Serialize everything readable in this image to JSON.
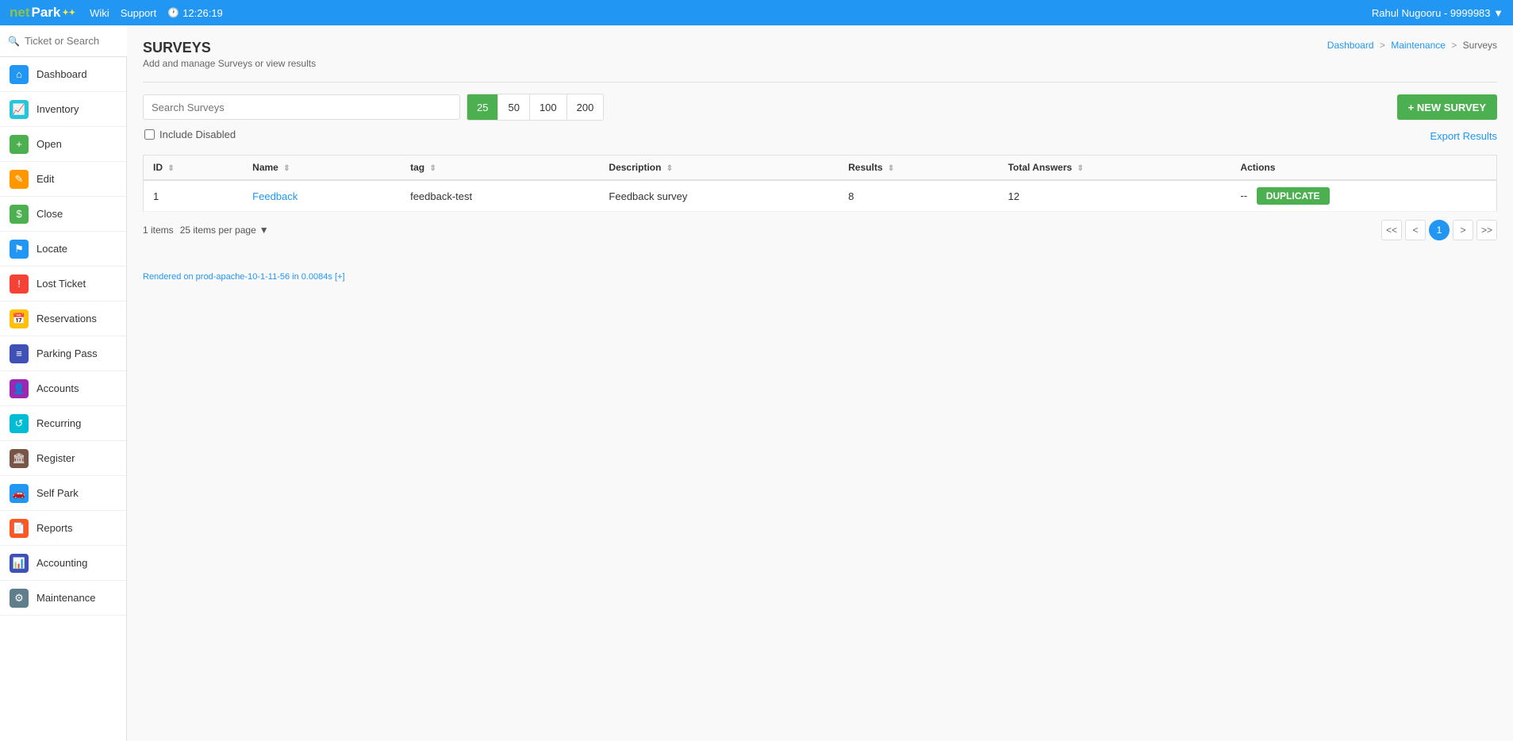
{
  "topnav": {
    "logo_net": "net",
    "logo_park": "Park",
    "wiki_label": "Wiki",
    "support_label": "Support",
    "clock_time": "12:26:19",
    "user_info": "Rahul Nugooru - 9999983 ▼"
  },
  "search": {
    "placeholder": "Ticket or Search"
  },
  "sidebar": {
    "items": [
      {
        "id": "dashboard",
        "label": "Dashboard",
        "icon": "⌂",
        "icon_class": "icon-blue"
      },
      {
        "id": "inventory",
        "label": "Inventory",
        "icon": "📈",
        "icon_class": "icon-teal"
      },
      {
        "id": "open",
        "label": "Open",
        "icon": "+",
        "icon_class": "icon-green"
      },
      {
        "id": "edit",
        "label": "Edit",
        "icon": "✎",
        "icon_class": "icon-orange"
      },
      {
        "id": "close",
        "label": "Close",
        "icon": "$",
        "icon_class": "icon-green"
      },
      {
        "id": "locate",
        "label": "Locate",
        "icon": "⚑",
        "icon_class": "icon-blue"
      },
      {
        "id": "lost-ticket",
        "label": "Lost Ticket",
        "icon": "!",
        "icon_class": "icon-red"
      },
      {
        "id": "reservations",
        "label": "Reservations",
        "icon": "📅",
        "icon_class": "icon-amber"
      },
      {
        "id": "parking-pass",
        "label": "Parking Pass",
        "icon": "≡",
        "icon_class": "icon-indigo"
      },
      {
        "id": "accounts",
        "label": "Accounts",
        "icon": "👤",
        "icon_class": "icon-purple"
      },
      {
        "id": "recurring",
        "label": "Recurring",
        "icon": "↺",
        "icon_class": "icon-cyan"
      },
      {
        "id": "register",
        "label": "Register",
        "icon": "🏛",
        "icon_class": "icon-brown"
      },
      {
        "id": "self-park",
        "label": "Self Park",
        "icon": "🚗",
        "icon_class": "icon-blue"
      },
      {
        "id": "reports",
        "label": "Reports",
        "icon": "📄",
        "icon_class": "icon-deeporange"
      },
      {
        "id": "accounting",
        "label": "Accounting",
        "icon": "📊",
        "icon_class": "icon-indigo"
      },
      {
        "id": "maintenance",
        "label": "Maintenance",
        "icon": "⚙",
        "icon_class": "icon-bluegrey"
      }
    ]
  },
  "page": {
    "title": "SURVEYS",
    "subtitle": "Add and manage Surveys or view results"
  },
  "breadcrumb": {
    "items": [
      "Dashboard",
      "Maintenance",
      "Surveys"
    ],
    "separators": [
      ">",
      ">"
    ]
  },
  "toolbar": {
    "search_placeholder": "Search Surveys",
    "per_page_options": [
      {
        "value": 25,
        "active": true
      },
      {
        "value": 50,
        "active": false
      },
      {
        "value": 100,
        "active": false
      },
      {
        "value": 200,
        "active": false
      }
    ],
    "new_survey_label": "+ NEW SURVEY",
    "include_disabled_label": "Include Disabled",
    "export_results_label": "Export Results"
  },
  "table": {
    "columns": [
      {
        "key": "id",
        "label": "ID"
      },
      {
        "key": "name",
        "label": "Name"
      },
      {
        "key": "tag",
        "label": "tag"
      },
      {
        "key": "description",
        "label": "Description"
      },
      {
        "key": "results",
        "label": "Results"
      },
      {
        "key": "total_answers",
        "label": "Total Answers"
      },
      {
        "key": "actions",
        "label": "Actions"
      }
    ],
    "rows": [
      {
        "id": "1",
        "name": "Feedback",
        "tag": "feedback-test",
        "description": "Feedback survey",
        "results": "8",
        "total_answers": "12",
        "actions_dash": "--",
        "duplicate_label": "DUPLICATE"
      }
    ]
  },
  "pagination": {
    "items_count": "1 items",
    "per_page_label": "25 items per page",
    "pages": [
      "<<",
      "<",
      "1",
      ">",
      ">>"
    ],
    "current_page": "1"
  },
  "footer": {
    "render_info": "Rendered on prod-apache-10-1-11-56 in 0.0084s [+]"
  }
}
